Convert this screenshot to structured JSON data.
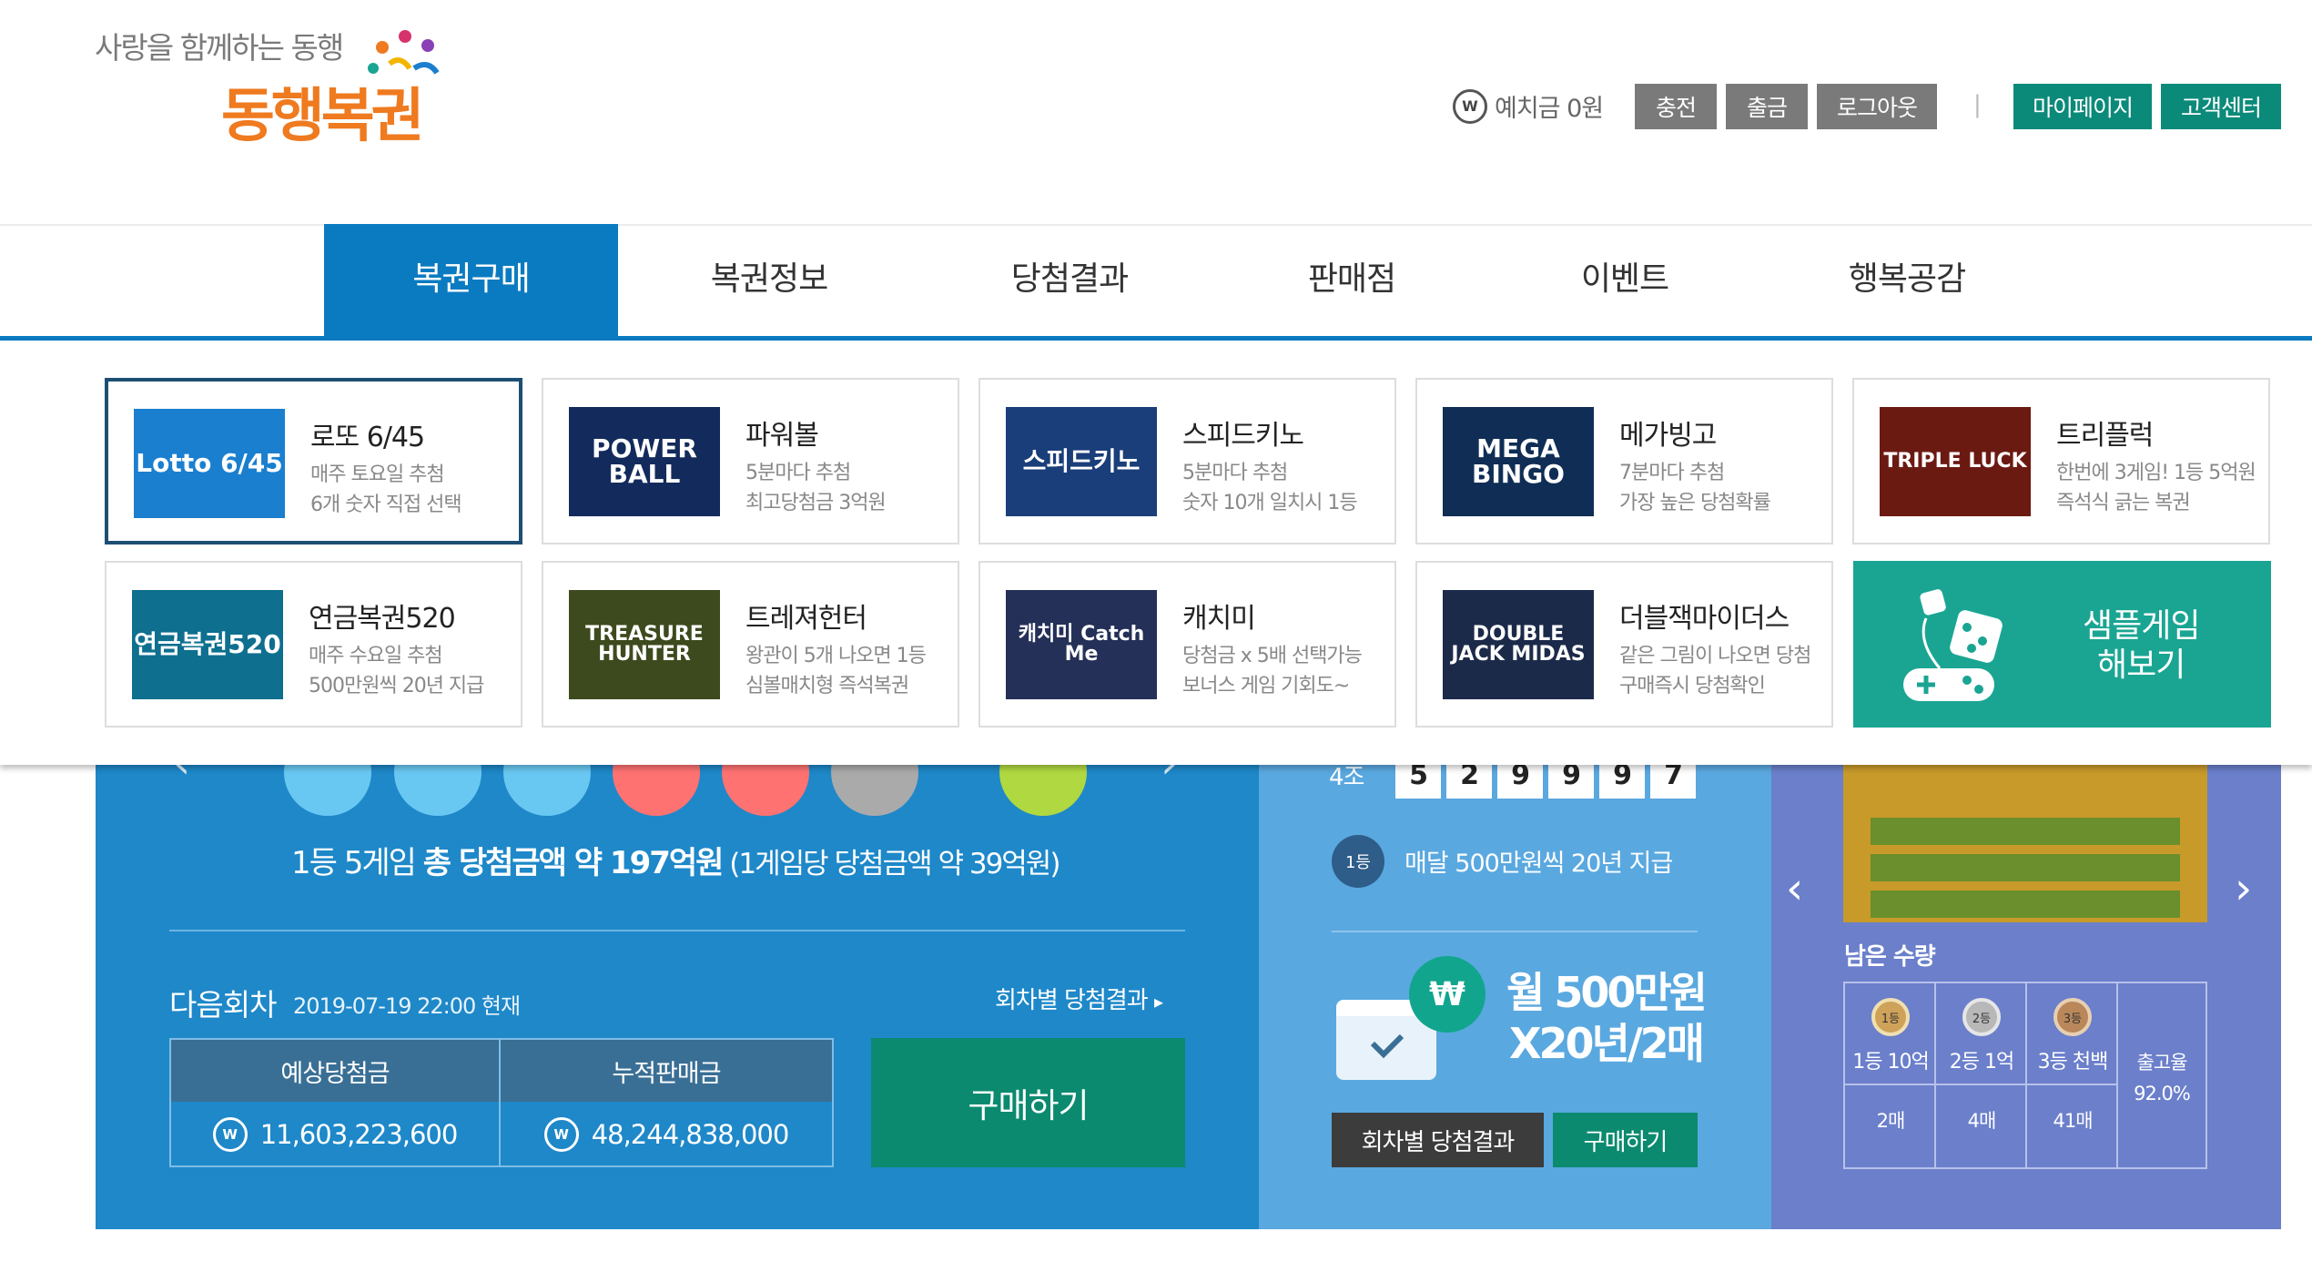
{
  "header": {
    "tagline": "사랑을 함께하는 동행",
    "brand": "동행복권",
    "wallet_icon": "W",
    "balance_label": "예치금 0원",
    "buttons": {
      "charge": "충전",
      "withdraw": "출금",
      "logout": "로그아웃",
      "separator": "|",
      "mypage": "마이페이지",
      "support": "고객센터"
    }
  },
  "nav": {
    "items": [
      "복권구매",
      "복권정보",
      "당첨결과",
      "판매점",
      "이벤트",
      "행복공감"
    ],
    "active": "복권구매"
  },
  "dropdown": {
    "games": [
      {
        "logo": "Lotto 6/45",
        "title": "로또 6/45",
        "line1": "매주 토요일 추첨",
        "line2": "6개 숫자 직접 선택",
        "bg": "#1b7fcf"
      },
      {
        "logo": "POWER BALL",
        "title": "파워볼",
        "line1": "5분마다 추첨",
        "line2": "최고당첨금 3억원",
        "bg": "#132b5c"
      },
      {
        "logo": "스피드키노",
        "title": "스피드키노",
        "line1": "5분마다 추첨",
        "line2": "숫자 10개 일치시 1등",
        "bg": "#1a3e7a"
      },
      {
        "logo": "MEGA BINGO",
        "title": "메가빙고",
        "line1": "7분마다 추첨",
        "line2": "가장 높은 당첨확률",
        "bg": "#0f2d55"
      },
      {
        "logo": "TRIPLE LUCK",
        "title": "트리플럭",
        "line1": "한번에 3게임! 1등 5억원",
        "line2": "즉석식 긁는 복권",
        "bg": "#6b1a12"
      },
      {
        "logo": "연금복권520",
        "title": "연금복권520",
        "line1": "매주 수요일 추첨",
        "line2": "500만원씩 20년 지급",
        "bg": "#0e6f8f"
      },
      {
        "logo": "TREASURE HUNTER",
        "title": "트레져헌터",
        "line1": "왕관이 5개 나오면 1등",
        "line2": "심볼매치형 즉석복권",
        "bg": "#3d4a1e"
      },
      {
        "logo": "캐치미 Catch Me",
        "title": "캐치미",
        "line1": "당첨금 x 5배 선택가능",
        "line2": "보너스 게임 기회도~",
        "bg": "#243057"
      },
      {
        "logo": "DOUBLE JACK MIDAS",
        "title": "더블잭마이더스",
        "line1": "같은 그림이 나오면 당첨",
        "line2": "구매즉시 당첨확인",
        "bg": "#1c2a4a"
      }
    ],
    "sample": {
      "line1": "샘플게임",
      "line2": "해보기"
    }
  },
  "lotto_section": {
    "balls": [
      {
        "color": "#69c8f2"
      },
      {
        "color": "#69c8f2"
      },
      {
        "color": "#69c8f2"
      },
      {
        "color": "#ff7272"
      },
      {
        "color": "#ff7272"
      },
      {
        "color": "#aaaaaa"
      },
      {
        "color": "#b0d840"
      }
    ],
    "prev_icon": "‹",
    "next_icon": "›",
    "jackpot_pre": "1등 5게임 ",
    "jackpot_bold": "총 당첨금액 약 197억원",
    "jackpot_post": " (1게임당 당첨금액 약 39억원)",
    "next_round_title": "다음회차",
    "next_round_date": "2019-07-19 22:00 현재",
    "results_link": "회차별 당첨결과",
    "link_arrow": "▸",
    "table": {
      "headers": [
        "예상당첨금",
        "누적판매금"
      ],
      "values": [
        "11,603,223,600",
        "48,244,838,000"
      ]
    },
    "buy_label": "구매하기"
  },
  "pension_section": {
    "group_label": "4조",
    "digits": [
      "5",
      "2",
      "9",
      "9",
      "9",
      "7"
    ],
    "rank_badge": "1등",
    "desc": "매달 500만원씩 20년 지급",
    "won_icon": "₩",
    "promo_line1": "월 500만원",
    "promo_line2": "X20년/2매",
    "btn_results": "회차별 당첨결과",
    "btn_buy": "구매하기"
  },
  "instant_section": {
    "prev_icon": "‹",
    "next_icon": "›",
    "remain_label": "남은 수량",
    "ranks": [
      {
        "medal": "1등",
        "label": "1등 10억",
        "count": "2매"
      },
      {
        "medal": "2등",
        "label": "2등 1억",
        "count": "4매"
      },
      {
        "medal": "3등",
        "label": "3등 천백",
        "count": "41매"
      }
    ],
    "rate_label": "출고율",
    "rate_value": "92.0%"
  }
}
